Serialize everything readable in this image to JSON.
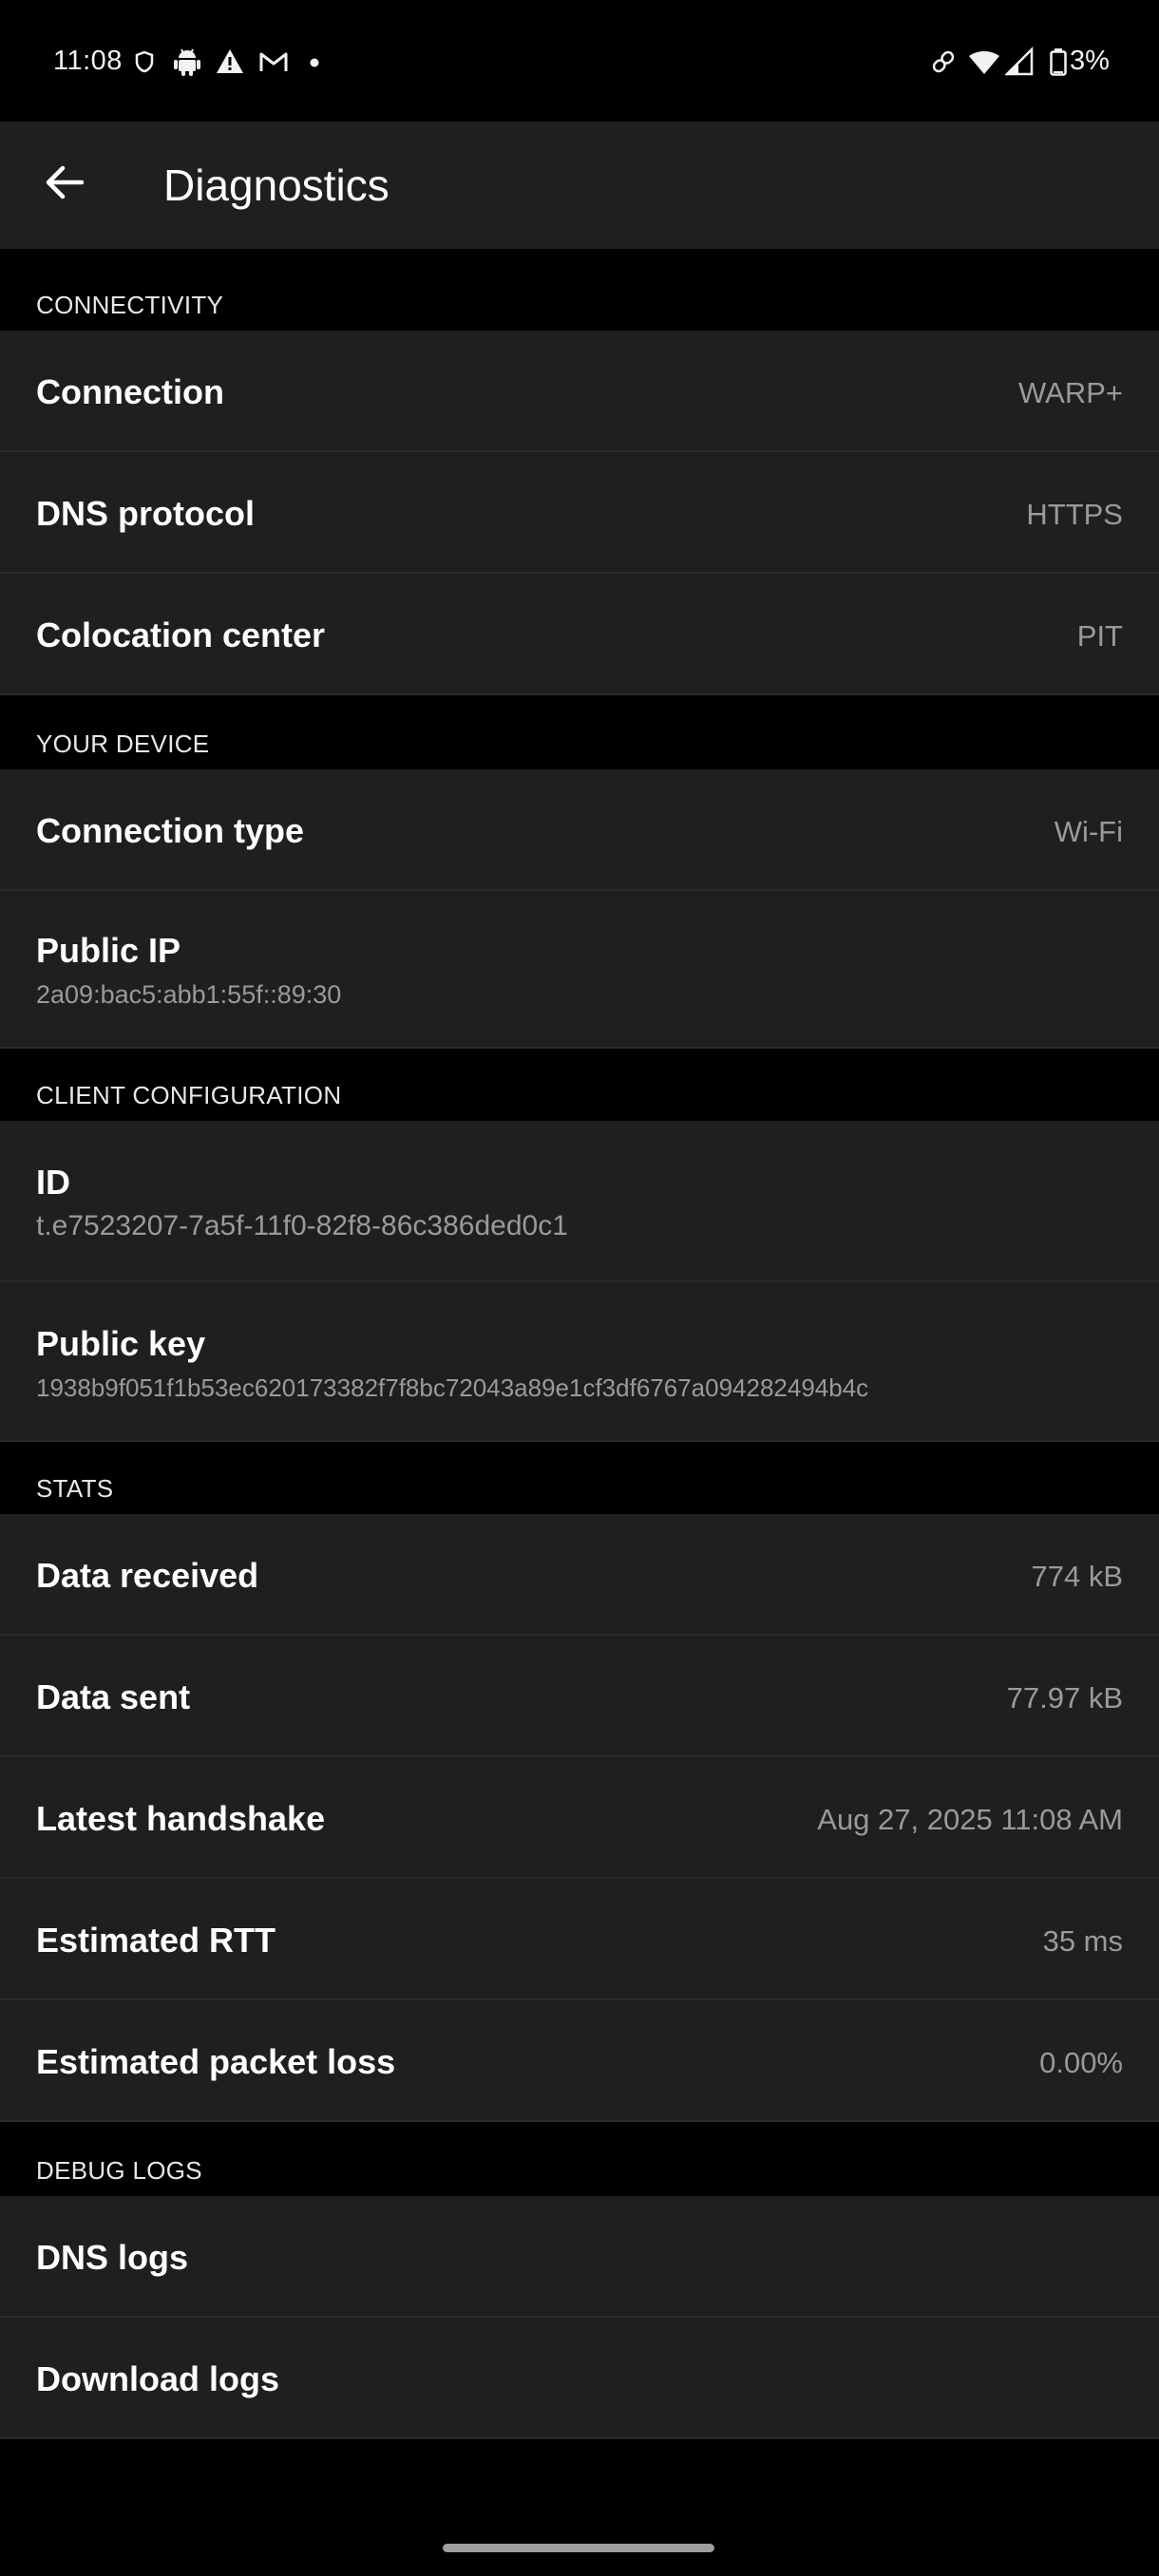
{
  "status_bar": {
    "time": "11:08",
    "battery_text": "3%",
    "icons": [
      "shield-icon",
      "android-icon",
      "warning-icon",
      "gmail-icon",
      "dot-icon",
      "link-icon",
      "wifi-icon",
      "signal-icon",
      "battery-icon"
    ]
  },
  "app_bar": {
    "title": "Diagnostics",
    "back_icon": "arrow-back-icon"
  },
  "sections": {
    "connectivity": {
      "header": "CONNECTIVITY",
      "connection": {
        "label": "Connection",
        "value": "WARP+"
      },
      "dns_protocol": {
        "label": "DNS protocol",
        "value": "HTTPS"
      },
      "colocation": {
        "label": "Colocation center",
        "value": "PIT"
      }
    },
    "your_device": {
      "header": "YOUR DEVICE",
      "connection_type": {
        "label": "Connection type",
        "value": "Wi-Fi"
      },
      "public_ip": {
        "label": "Public IP",
        "value": "2a09:bac5:abb1:55f::89:30"
      }
    },
    "client_configuration": {
      "header": "CLIENT CONFIGURATION",
      "id": {
        "label": "ID",
        "value": "t.e7523207-7a5f-11f0-82f8-86c386ded0c1"
      },
      "public_key": {
        "label": "Public key",
        "value": "1938b9f051f1b53ec620173382f7f8bc72043a89e1cf3df6767a094282494b4c"
      }
    },
    "stats": {
      "header": "STATS",
      "data_received": {
        "label": "Data received",
        "value": "774 kB"
      },
      "data_sent": {
        "label": "Data sent",
        "value": "77.97 kB"
      },
      "latest_handshake": {
        "label": "Latest handshake",
        "value": "Aug 27, 2025 11:08 AM"
      },
      "estimated_rtt": {
        "label": "Estimated RTT",
        "value": "35 ms"
      },
      "packet_loss": {
        "label": "Estimated packet loss",
        "value": "0.00%"
      }
    },
    "debug_logs": {
      "header": "DEBUG LOGS",
      "dns_logs": {
        "label": "DNS logs"
      },
      "download_logs": {
        "label": "Download logs"
      }
    }
  }
}
